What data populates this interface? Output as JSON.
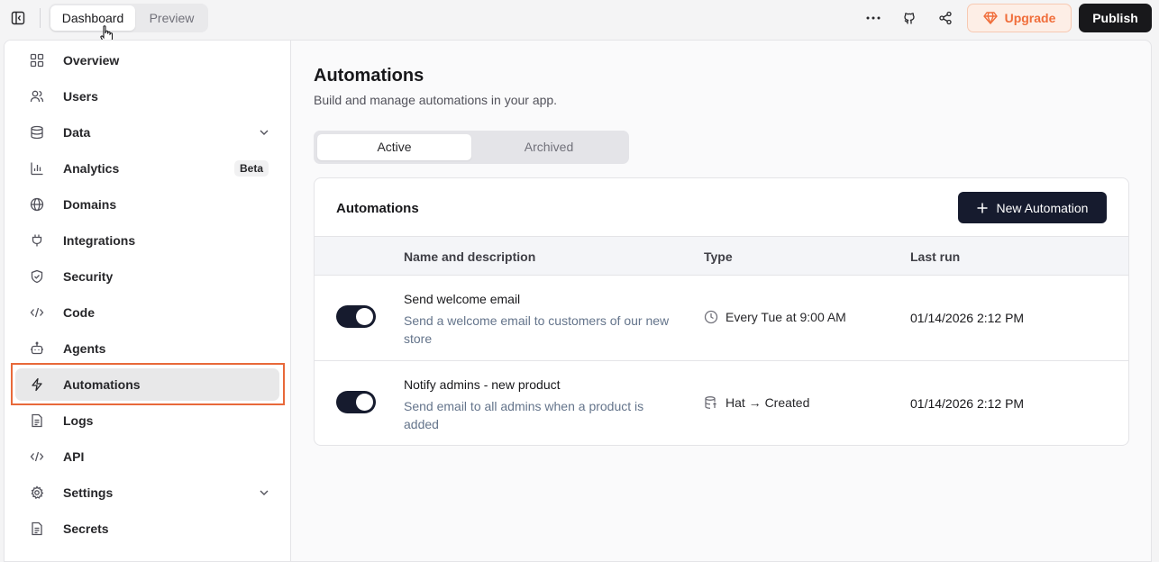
{
  "topbar": {
    "mode_tabs": [
      {
        "label": "Dashboard"
      },
      {
        "label": "Preview"
      }
    ],
    "upgrade_label": "Upgrade",
    "publish_label": "Publish",
    "accent_color": "#f06d3a"
  },
  "sidebar": {
    "items": [
      {
        "label": "Overview",
        "icon": "grid-icon"
      },
      {
        "label": "Users",
        "icon": "users-icon"
      },
      {
        "label": "Data",
        "icon": "database-icon",
        "expandable": true
      },
      {
        "label": "Analytics",
        "icon": "bar-chart-icon",
        "badge": "Beta"
      },
      {
        "label": "Domains",
        "icon": "globe-icon"
      },
      {
        "label": "Integrations",
        "icon": "plug-icon"
      },
      {
        "label": "Security",
        "icon": "shield-icon"
      },
      {
        "label": "Code",
        "icon": "code-icon"
      },
      {
        "label": "Agents",
        "icon": "bot-icon"
      },
      {
        "label": "Automations",
        "icon": "lightning-icon",
        "selected": true
      },
      {
        "label": "Logs",
        "icon": "file-text-icon"
      },
      {
        "label": "API",
        "icon": "code-icon"
      },
      {
        "label": "Settings",
        "icon": "gear-icon",
        "expandable": true
      },
      {
        "label": "Secrets",
        "icon": "file-text-icon"
      }
    ]
  },
  "main": {
    "title": "Automations",
    "subtitle": "Build and manage automations in your app.",
    "tabs": [
      {
        "label": "Active"
      },
      {
        "label": "Archived"
      }
    ],
    "card": {
      "title": "Automations",
      "new_button_label": "New Automation",
      "columns": [
        "Name and description",
        "Type",
        "Last run"
      ],
      "rows": [
        {
          "name": "Send welcome email",
          "description": "Send a welcome email to customers of our new store",
          "type": "Every Tue at 9:00 AM",
          "type_icon": "clock-icon",
          "last_run": "01/14/2026 2:12 PM",
          "enabled": true
        },
        {
          "name": "Notify admins - new product",
          "description": "Send email to all admins when a product is added",
          "type": "Hat → Created",
          "type_icon": "database-event-icon",
          "last_run": "01/14/2026 2:12 PM",
          "enabled": true
        }
      ]
    }
  }
}
